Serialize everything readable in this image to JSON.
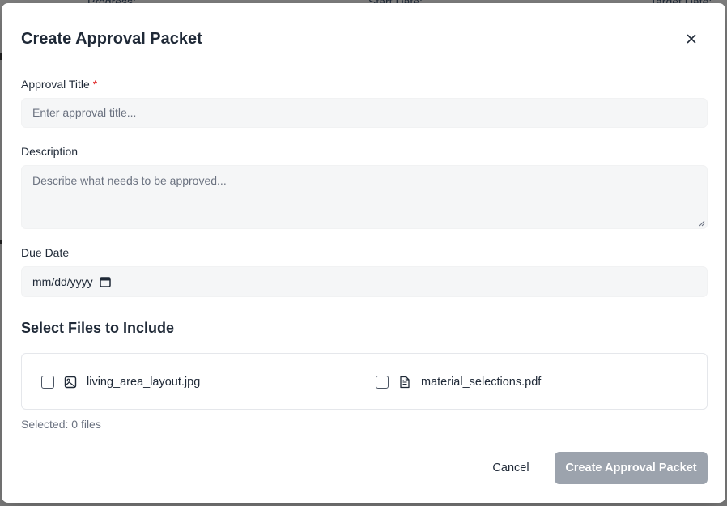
{
  "background": {
    "labels": [
      "Progress:",
      "Start Date:",
      "Target Date:"
    ]
  },
  "modal": {
    "title": "Create Approval Packet",
    "close_icon": "close-icon",
    "approval_title": {
      "label": "Approval Title",
      "required_marker": "*",
      "placeholder": "Enter approval title..."
    },
    "description": {
      "label": "Description",
      "placeholder": "Describe what needs to be approved..."
    },
    "due_date": {
      "label": "Due Date",
      "value": "mm/dd/yyyy",
      "icon": "calendar-icon"
    },
    "files_section": {
      "title": "Select Files to Include",
      "files": [
        {
          "name": "living_area_layout.jpg",
          "icon": "image-icon",
          "checked": false
        },
        {
          "name": "material_selections.pdf",
          "icon": "document-icon",
          "checked": false
        }
      ],
      "selected_text": "Selected: 0 files"
    },
    "actions": {
      "cancel_label": "Cancel",
      "create_label": "Create Approval Packet"
    }
  },
  "colors": {
    "required": "#e02424",
    "primary_disabled": "#9ca3ad",
    "field_bg": "#f5f6f7"
  }
}
